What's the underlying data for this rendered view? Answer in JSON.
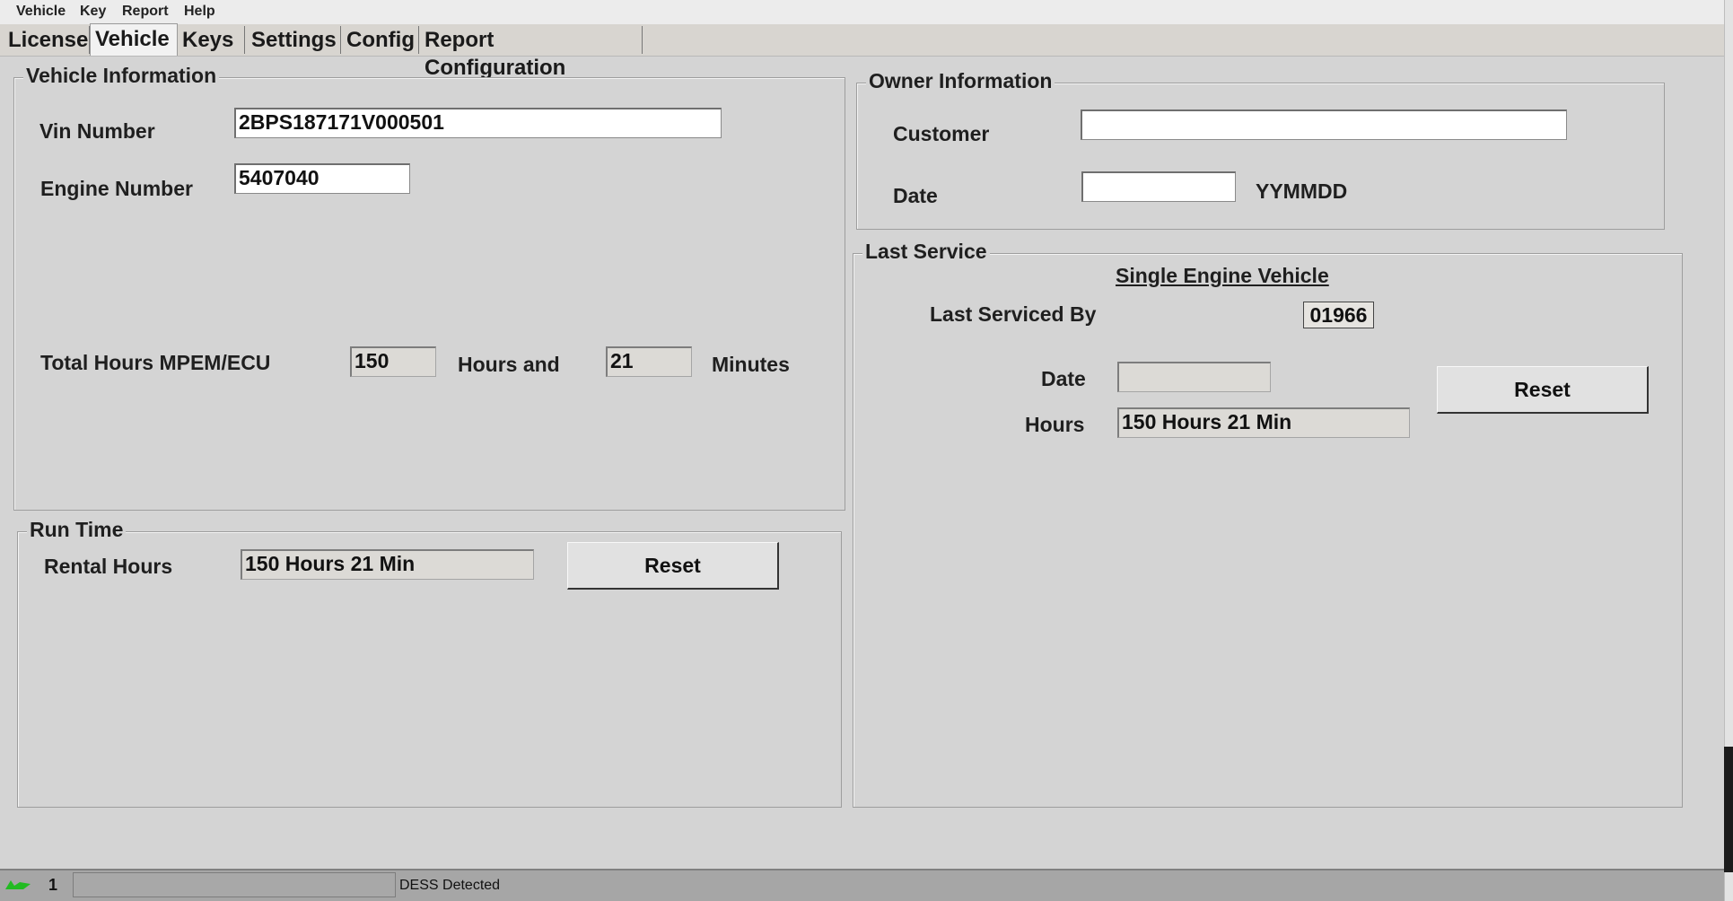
{
  "menu": [
    "Vehicle",
    "Key",
    "Report",
    "Help"
  ],
  "tabs": [
    "License",
    "Vehicle",
    "Keys",
    "Settings",
    "Config",
    "Report Configuration"
  ],
  "vehicle_info": {
    "title": "Vehicle Information",
    "vin_label": "Vin Number",
    "vin_value": "2BPS187171V000501",
    "engine_label": "Engine Number",
    "engine_value": "5407040",
    "total_hours_label": "Total Hours MPEM/ECU",
    "hours_value": "150",
    "hours_and_label": "Hours and",
    "minutes_value": "21",
    "minutes_label": "Minutes"
  },
  "run_time": {
    "title": "Run Time",
    "rental_label": "Rental Hours",
    "rental_value": "150 Hours  21 Min",
    "reset_label": "Reset"
  },
  "owner_info": {
    "title": "Owner Information",
    "customer_label": "Customer",
    "customer_value": "",
    "date_label": "Date",
    "date_value": "",
    "date_format": "YYMMDD"
  },
  "last_service": {
    "title": "Last Service",
    "heading": "Single Engine Vehicle",
    "serviced_by_label": "Last Serviced By",
    "serviced_by_value": "01966",
    "date_label": "Date",
    "date_value": "",
    "hours_label": "Hours",
    "hours_value": "150 Hours  21 Min",
    "reset_label": "Reset"
  },
  "status": {
    "count": "1",
    "message": "DESS Detected"
  },
  "colors": {
    "background": "#d4d4d4",
    "menubar": "#ececec",
    "statusbar": "#a6a6a6",
    "status_icon": "#22bb22"
  }
}
